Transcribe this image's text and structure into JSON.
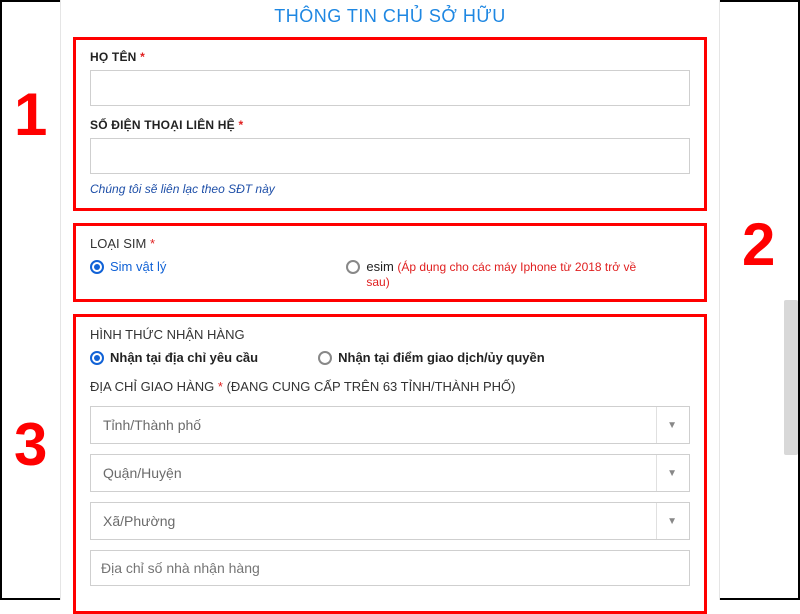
{
  "title": "THÔNG TIN CHỦ SỞ HỮU",
  "annotations": {
    "n1": "1",
    "n2": "2",
    "n3": "3"
  },
  "owner": {
    "name_label": "HỌ TÊN",
    "name_value": "",
    "phone_label": "SỐ ĐIỆN THOẠI LIÊN HỆ",
    "phone_value": "",
    "phone_hint": "Chúng tôi sẽ liên lạc theo SĐT này",
    "required_mark": "*"
  },
  "sim": {
    "label": "LOẠI SIM",
    "required_mark": "*",
    "options": {
      "physical": {
        "label": "Sim vật lý",
        "checked": true
      },
      "esim": {
        "label": "esim",
        "note": "(Áp dụng cho các máy Iphone từ 2018 trở về sau)",
        "checked": false
      }
    }
  },
  "delivery": {
    "heading": "HÌNH THỨC NHẬN HÀNG",
    "options": {
      "address": {
        "label": "Nhận tại địa chỉ yêu cầu",
        "checked": true
      },
      "store": {
        "label": "Nhận tại điểm giao dịch/ủy quyền",
        "checked": false
      }
    },
    "address_label": "ĐỊA CHỈ GIAO HÀNG",
    "required_mark": "*",
    "address_suffix": "(ĐANG CUNG CẤP TRÊN 63 TỈNH/THÀNH PHỐ)",
    "province_placeholder": "Tỉnh/Thành phố",
    "district_placeholder": "Quận/Huyện",
    "ward_placeholder": "Xã/Phường",
    "street_placeholder": "Địa chỉ số nhà nhận hàng"
  }
}
